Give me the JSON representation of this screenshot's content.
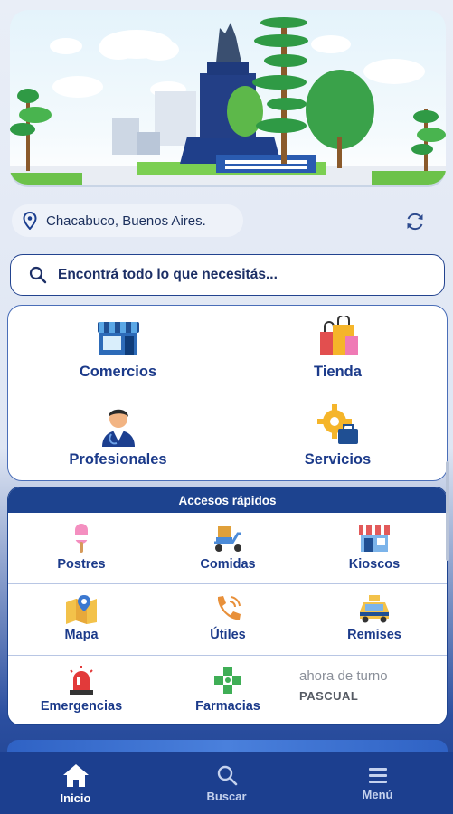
{
  "location": {
    "text": "Chacabuco, Buenos Aires."
  },
  "search": {
    "placeholder": "Encontrá todo lo que necesitás..."
  },
  "categories": [
    {
      "label": "Comercios",
      "icon": "store-icon"
    },
    {
      "label": "Tienda",
      "icon": "shopping-bags-icon"
    },
    {
      "label": "Profesionales",
      "icon": "professional-person-icon"
    },
    {
      "label": "Servicios",
      "icon": "gear-toolbox-icon"
    }
  ],
  "quick_access": {
    "title": "Accesos rápidos",
    "items": [
      {
        "label": "Postres",
        "icon": "ice-cream-icon"
      },
      {
        "label": "Comidas",
        "icon": "delivery-scooter-icon"
      },
      {
        "label": "Kioscos",
        "icon": "kiosk-icon"
      },
      {
        "label": "Mapa",
        "icon": "map-pin-icon"
      },
      {
        "label": "Útiles",
        "icon": "phone-icon"
      },
      {
        "label": "Remises",
        "icon": "taxi-icon"
      },
      {
        "label": "Emergencias",
        "icon": "siren-icon"
      },
      {
        "label": "Farmacias",
        "icon": "pharmacy-cross-icon"
      }
    ],
    "turno": {
      "line1": "ahora de turno",
      "line2": "PASCUAL"
    }
  },
  "bottom_nav": [
    {
      "label": "Inicio",
      "icon": "home-icon",
      "active": true
    },
    {
      "label": "Buscar",
      "icon": "search-icon",
      "active": false
    },
    {
      "label": "Menú",
      "icon": "hamburger-menu-icon",
      "active": false
    }
  ],
  "colors": {
    "primary": "#1d438f",
    "accent": "#3b66c4"
  }
}
